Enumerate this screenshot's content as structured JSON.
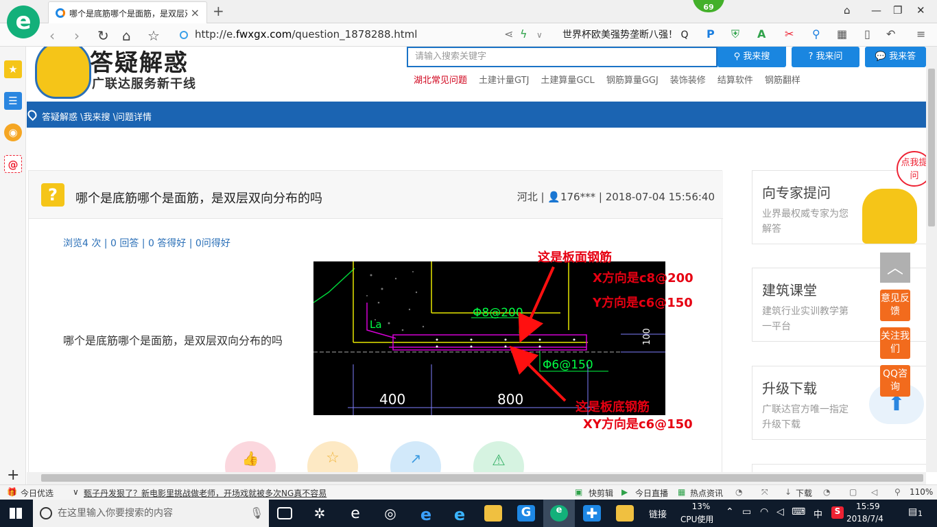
{
  "browser": {
    "tab_title": "哪个是底筋哪个是面筋，是双层双向分布的吗",
    "new_tab": "+",
    "url_prefix": "http://e.",
    "url_domain": "fwxgx.com",
    "url_path": "/question_1878288.html",
    "badge_count": "69",
    "search_hint": "世界杯欧美强势垄断八强！ Q",
    "logo": "e"
  },
  "site": {
    "title": "答疑解惑",
    "subtitle": "广联达服务新干线",
    "search_placeholder": "请输入搜索关键字",
    "btn_search": "我来搜",
    "btn_ask": "我来问",
    "btn_answer": "我来答",
    "hot_links": [
      "湖北常见问题",
      "土建计量GTJ",
      "土建算量GCL",
      "钢筋算量GGJ",
      "装饰装修",
      "结算软件",
      "钢筋翻样"
    ],
    "breadcrumb": "答疑解惑 \\我来搜 \\问题详情"
  },
  "question": {
    "icon": "?",
    "title": "哪个是底筋哪个是面筋，是双层双向分布的吗",
    "meta": "河北 | 👤176*** | 2018-07-04 15:56:40",
    "stats": "浏览4 次 | 0 回答 | 0 答得好 | 0问得好",
    "body": "哪个是底筋哪个是面筋，是双层双向分布的吗"
  },
  "annotations": {
    "top_label": "这是板面钢筋",
    "x_dir": "X方向是c8@200",
    "y_dir": "Y方向是c6@150",
    "bottom_label": "这是板底钢筋",
    "xy_dir": "XY方向是c6@150"
  },
  "cad": {
    "la": "La",
    "rebar_top": "Φ8@200",
    "rebar_bottom": "Φ6@150",
    "dim_100": "100",
    "dim_400": "400",
    "dim_800": "800"
  },
  "sidebar_right": {
    "expert_title": "向专家提问",
    "expert_desc": "业界最权威专家为您解答",
    "class_title": "建筑课堂",
    "class_desc": "建筑行业实训教学第一平台",
    "upgrade_title": "升级下载",
    "upgrade_desc": "广联达官方唯一指定升级下载",
    "click_ask": "点我提问",
    "feedback": "意见反馈",
    "follow": "关注我们",
    "qq": "QQ咨询"
  },
  "statusbar": {
    "daily": "今日优选",
    "news": "甄子丹发狠了？新电影里挑战做老师，开场戏就被多次NG真不容易",
    "clip": "快剪辑",
    "live": "今日直播",
    "hot": "热点资讯",
    "download": "下载",
    "zoom": "110%"
  },
  "taskbar": {
    "search_placeholder": "在这里输入你要搜索的内容",
    "link": "链接",
    "cpu": "13%",
    "cpu_label": "CPU使用",
    "ime": "中",
    "time": "15:59",
    "date": "2018/7/4",
    "notif": "1"
  },
  "colors": {
    "brand_blue": "#1b64b2",
    "accent_red": "#e60012",
    "cad_green": "#00ff44",
    "cad_magenta": "#d400d4",
    "cad_yellow": "#e8e800"
  }
}
